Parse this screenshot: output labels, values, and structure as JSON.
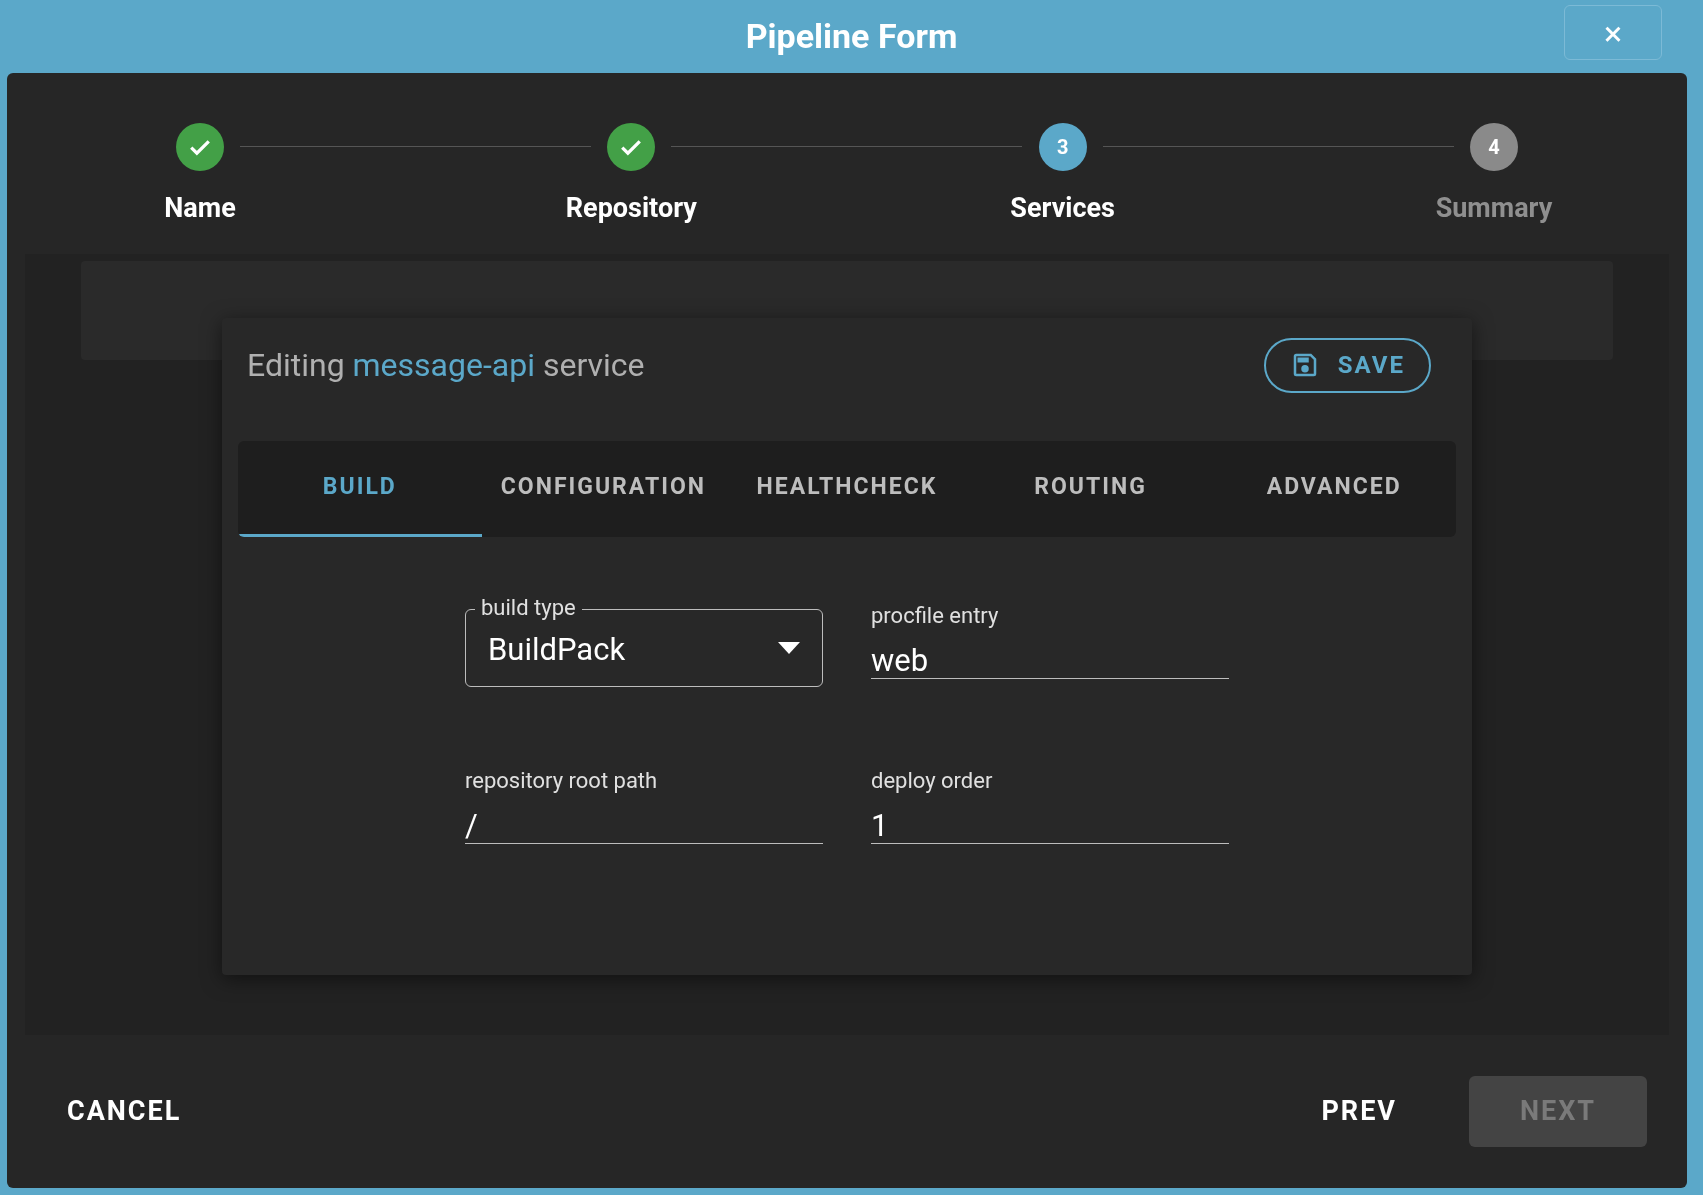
{
  "window": {
    "title": "Pipeline Form",
    "close": "×"
  },
  "steps": [
    {
      "label": "Name",
      "completed": true,
      "active": false
    },
    {
      "label": "Repository",
      "completed": true,
      "active": false
    },
    {
      "label": "Services",
      "number": "3",
      "completed": false,
      "active": true
    },
    {
      "label": "Summary",
      "number": "4",
      "completed": false,
      "active": false
    }
  ],
  "editor": {
    "heading": "Editing **message-api** service",
    "save": "SAVE",
    "tabs": [
      {
        "label": "BUILD",
        "selected": true
      },
      {
        "label": "CONFIGURATION",
        "selected": false
      },
      {
        "label": "HEALTHCHECK",
        "selected": false
      },
      {
        "label": "ROUTING",
        "selected": false
      },
      {
        "label": "ADVANCED",
        "selected": false
      }
    ],
    "fields": [
      {
        "kind": "select",
        "label": "build type",
        "value": "BuildPack"
      },
      {
        "kind": "text",
        "label": "procfile entry",
        "value": "web"
      },
      {
        "kind": "text",
        "label": "repository root path",
        "value": "/"
      },
      {
        "kind": "text",
        "label": "deploy order",
        "value": "1"
      }
    ]
  },
  "footer": {
    "cancel": "CANCEL",
    "prev": "PREV",
    "next": "NEXT",
    "next_disabled": true
  }
}
